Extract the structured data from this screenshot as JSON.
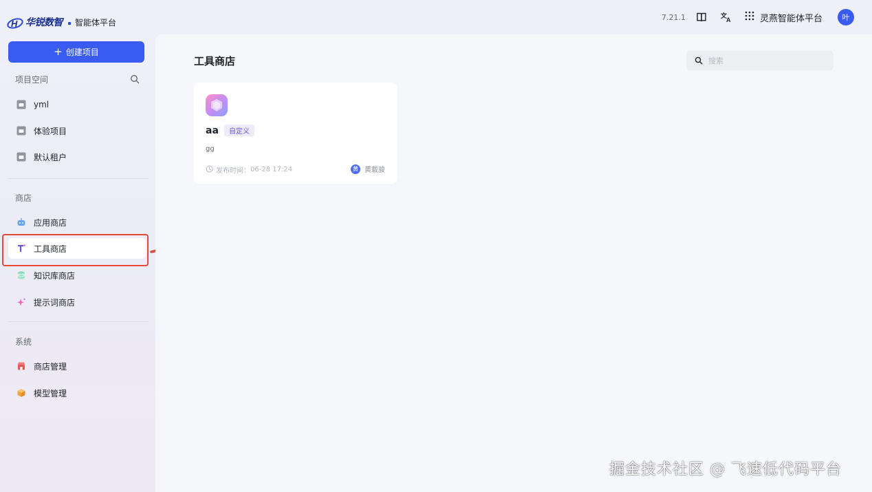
{
  "brand": {
    "name": "华锐数智",
    "subtitle": "智能体平台"
  },
  "sidebar": {
    "create_button": "创建项目",
    "project_section": "项目空间",
    "projects": [
      "yml",
      "体验项目",
      "默认租户"
    ],
    "store_section": "商店",
    "stores": [
      "应用商店",
      "工具商店",
      "知识库商店",
      "提示词商店"
    ],
    "active_store": "工具商店",
    "system_section": "系统",
    "system_items": [
      "商店管理",
      "模型管理"
    ]
  },
  "topbar": {
    "version": "7.21.1",
    "platform": "灵燕智能体平台",
    "avatar": "叶"
  },
  "main": {
    "title": "工具商店",
    "search_placeholder": "搜索",
    "cards": [
      {
        "name": "aa",
        "tag": "自定义",
        "desc": "gg",
        "time_label": "发布时间：",
        "time": "06-28 17:24",
        "author_initial": "黄",
        "author": "黄载骏"
      }
    ]
  },
  "watermark": "掘金技术社区 @ 飞速低代码平台",
  "colors": {
    "accent": "#3a5bef",
    "highlight": "#e5483a",
    "tag_text": "#6b56d6"
  },
  "icons": {
    "projects": "folder-icon",
    "stores": [
      "robot-icon",
      "tool-icon",
      "database-icon",
      "sparkle-icon"
    ],
    "system": [
      "store-icon",
      "cube-icon"
    ]
  }
}
